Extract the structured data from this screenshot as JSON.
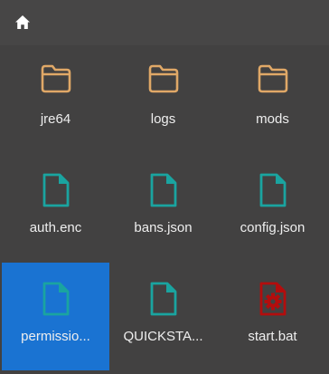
{
  "toolbar": {
    "home_icon": "home-icon"
  },
  "files": [
    {
      "name": "jre64",
      "type": "folder",
      "icon": "folder-icon"
    },
    {
      "name": "logs",
      "type": "folder",
      "icon": "folder-icon"
    },
    {
      "name": "mods",
      "type": "folder",
      "icon": "folder-icon"
    },
    {
      "name": "auth.enc",
      "type": "file",
      "icon": "file-icon"
    },
    {
      "name": "bans.json",
      "type": "file",
      "icon": "file-icon"
    },
    {
      "name": "config.json",
      "type": "file",
      "icon": "file-icon"
    },
    {
      "name": "permissio...",
      "type": "file",
      "icon": "file-icon",
      "selected": true
    },
    {
      "name": "QUICKSTA...",
      "type": "file",
      "icon": "file-icon"
    },
    {
      "name": "start.bat",
      "type": "executable",
      "icon": "gear-file-icon"
    }
  ],
  "colors": {
    "background": "#424141",
    "folder": "#e0a867",
    "file": "#1aa4a0",
    "executable": "#b30d0d",
    "selection": "#1a73d2",
    "text": "#eeeeee"
  }
}
